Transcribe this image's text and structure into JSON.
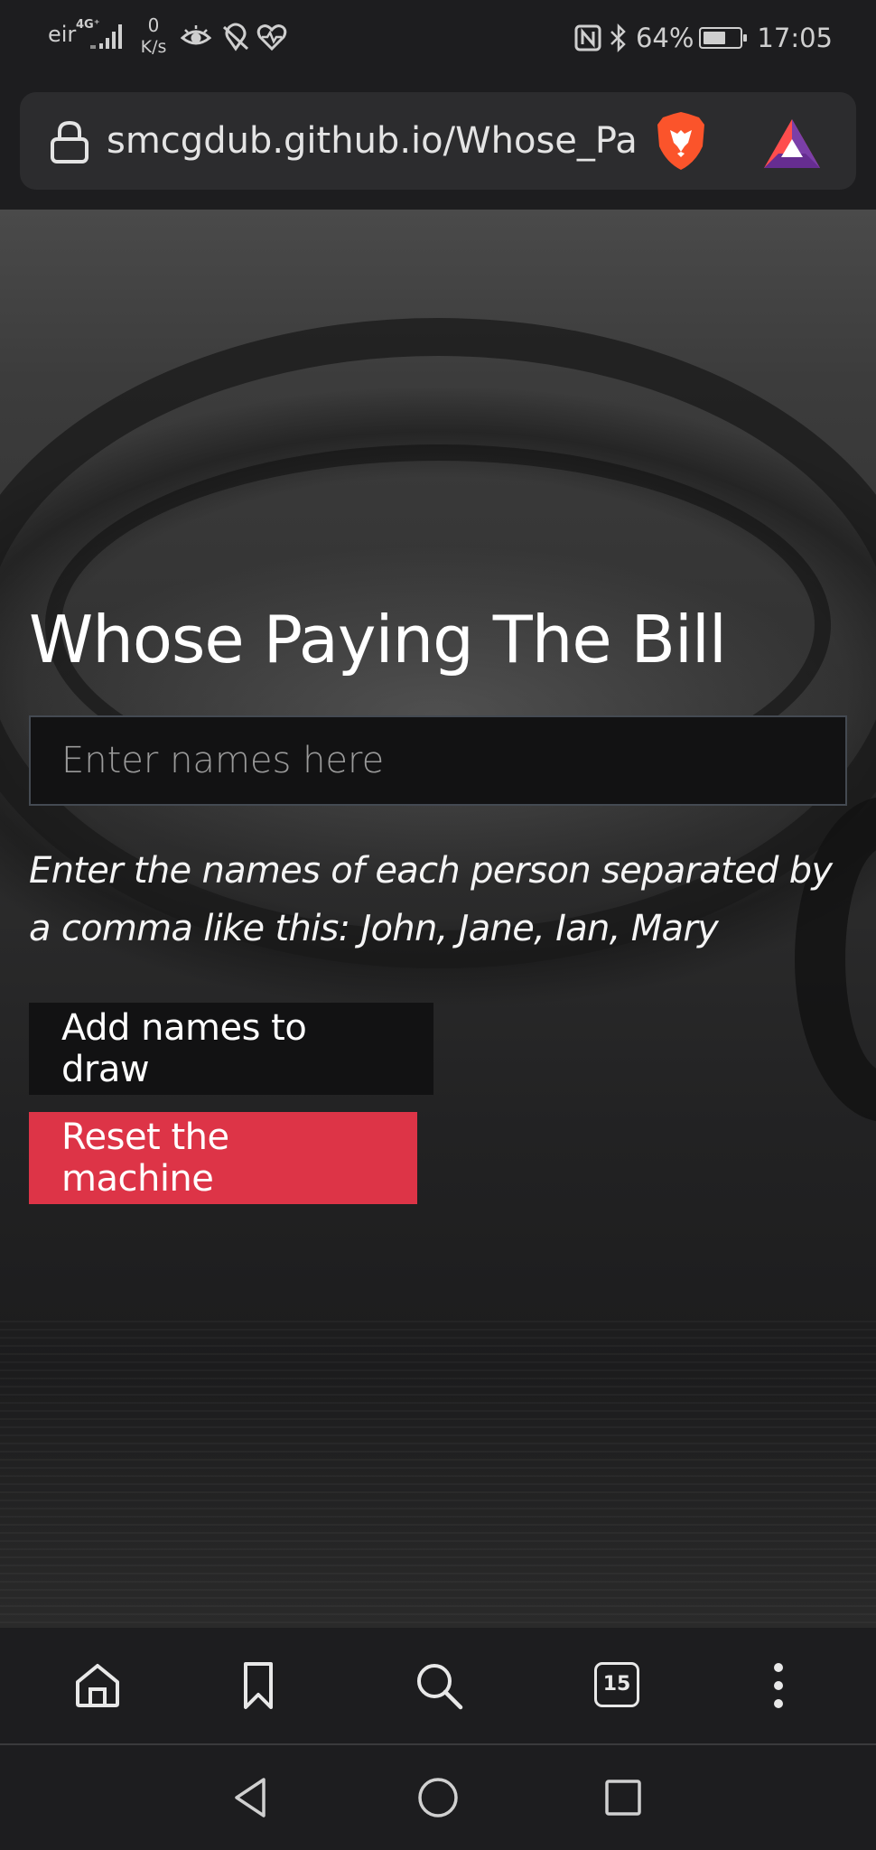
{
  "status_bar": {
    "carrier": "eir",
    "network_type": "4G⁺",
    "speed_value": "0",
    "speed_unit": "K/s",
    "battery": "64%",
    "battery_level": 0.64,
    "time": "17:05",
    "icons": [
      "signal-icon",
      "eye-icon",
      "location-off-icon",
      "health-heart-icon",
      "nfc-icon",
      "bluetooth-icon",
      "battery-icon"
    ]
  },
  "browser": {
    "url": "smcgdub.github.io/Whose_Pa",
    "icons": [
      "lock-icon",
      "brave-shields-icon",
      "brave-rewards-icon"
    ]
  },
  "page": {
    "title": "Whose Paying The Bill",
    "input_placeholder": "Enter names here",
    "input_value": "",
    "help_text": "Enter the names of each person separated by a comma like this: John, Jane, Ian, Mary",
    "add_button": "Add names to draw",
    "reset_button": "Reset the machine",
    "colors": {
      "reset_button": "#dd3447",
      "add_button": "#121213"
    }
  },
  "toolbar": {
    "tabs_count": "15",
    "icons": [
      "home-icon",
      "bookmark-icon",
      "search-icon",
      "tabs-icon",
      "more-menu-icon"
    ]
  },
  "nav_bar": {
    "icons": [
      "back-icon",
      "home-circle-icon",
      "recents-icon"
    ]
  }
}
